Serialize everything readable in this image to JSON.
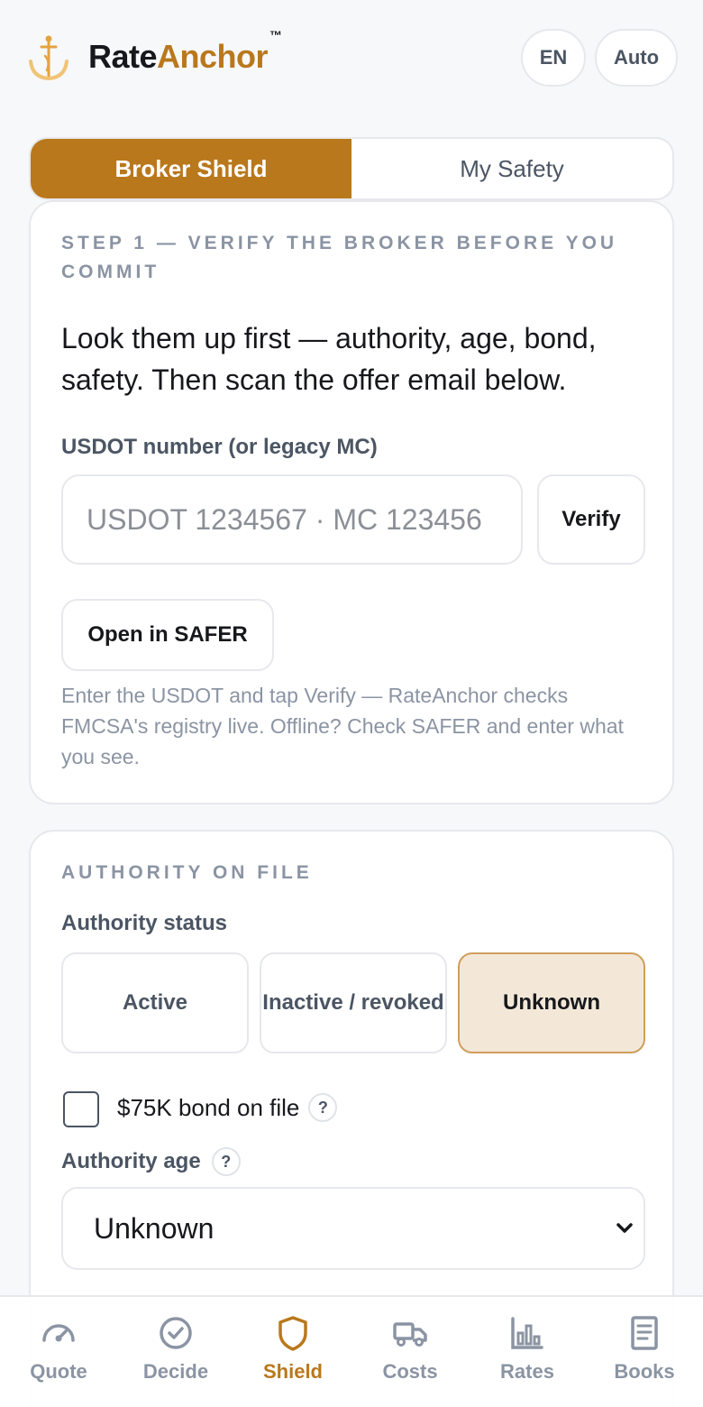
{
  "app": {
    "brand_part1": "Rate",
    "brand_part2": "Anchor",
    "trademark": "™",
    "accent_color": "#b9781c"
  },
  "header": {
    "language": "EN",
    "theme_mode": "Auto"
  },
  "segment": {
    "tabs": [
      {
        "label": "Broker Shield",
        "active": true
      },
      {
        "label": "My Safety",
        "active": false
      }
    ]
  },
  "step1": {
    "eyebrow": "STEP 1 — VERIFY THE BROKER BEFORE YOU COMMIT",
    "lead": "Look them up first — authority, age, bond, safety. Then scan the offer email below.",
    "field_label": "USDOT number (or legacy MC)",
    "input_value": "",
    "input_placeholder": "USDOT 1234567 · MC 123456",
    "verify_label": "Verify",
    "safer_label": "Open in SAFER",
    "help_text": "Enter the USDOT and tap Verify — RateAnchor checks FMCSA's registry live. Offline? Check SAFER and enter what you see."
  },
  "authority": {
    "eyebrow": "AUTHORITY ON FILE",
    "status_label": "Authority status",
    "options": [
      {
        "label": "Active",
        "selected": false
      },
      {
        "label": "Inactive / revoked",
        "selected": false
      },
      {
        "label": "Unknown",
        "selected": true
      }
    ],
    "bond_label": "$75K bond on file",
    "bond_checked": false,
    "help_glyph": "?",
    "age_label": "Authority age",
    "age_value": "Unknown"
  },
  "tabbar": {
    "items": [
      {
        "label": "Quote",
        "icon": "gauge-icon",
        "active": false
      },
      {
        "label": "Decide",
        "icon": "check-circle-icon",
        "active": false
      },
      {
        "label": "Shield",
        "icon": "shield-icon",
        "active": true
      },
      {
        "label": "Costs",
        "icon": "truck-icon",
        "active": false
      },
      {
        "label": "Rates",
        "icon": "bar-chart-icon",
        "active": false
      },
      {
        "label": "Books",
        "icon": "document-icon",
        "active": false
      }
    ]
  }
}
